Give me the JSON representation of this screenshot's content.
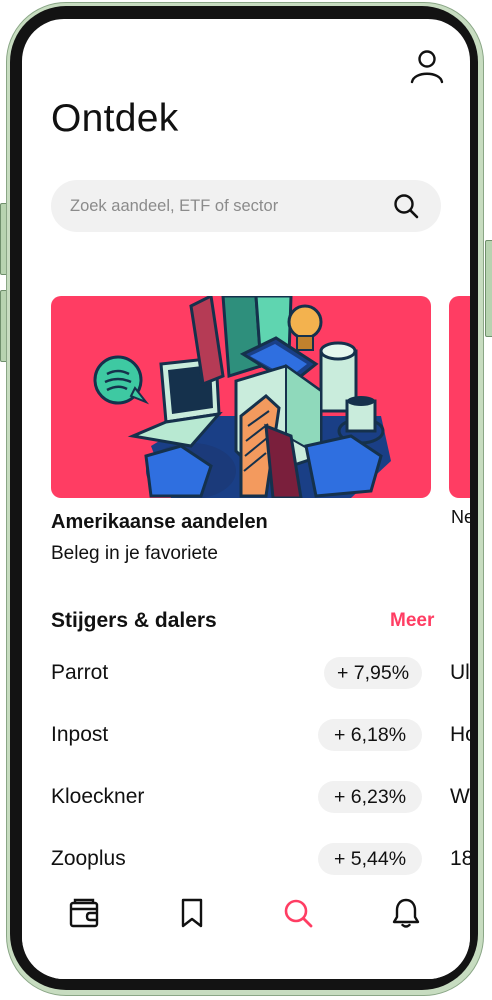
{
  "screen": {
    "title": "Ontdek"
  },
  "search": {
    "placeholder": "Zoek aandeel, ETF of sector",
    "icon": "search-icon"
  },
  "featured": {
    "cards": [
      {
        "title": "Amerikaanse aandelen",
        "subtitle": "Beleg in je favoriete"
      },
      {
        "title": "Ne"
      }
    ]
  },
  "movers": {
    "title": "Stijgers & dalers",
    "more_label": "Meer",
    "rows": [
      {
        "name": "Parrot",
        "change": "+ 7,95%",
        "next": "Ul"
      },
      {
        "name": "Inpost",
        "change": "+ 6,18%",
        "next": "Ho"
      },
      {
        "name": "Kloeckner",
        "change": "+ 6,23%",
        "next": "W"
      },
      {
        "name": "Zooplus",
        "change": "+ 5,44%",
        "next": "18"
      }
    ]
  },
  "bottom_nav": {
    "items": [
      {
        "icon": "wallet-icon",
        "active": false
      },
      {
        "icon": "bookmark-icon",
        "active": false
      },
      {
        "icon": "search-icon",
        "active": true
      },
      {
        "icon": "bell-icon",
        "active": false
      }
    ]
  },
  "colors": {
    "accent": "#ff3d63",
    "pill_bg": "#f1f1f1",
    "frame": "#131313",
    "case": "#c7dcc0"
  }
}
